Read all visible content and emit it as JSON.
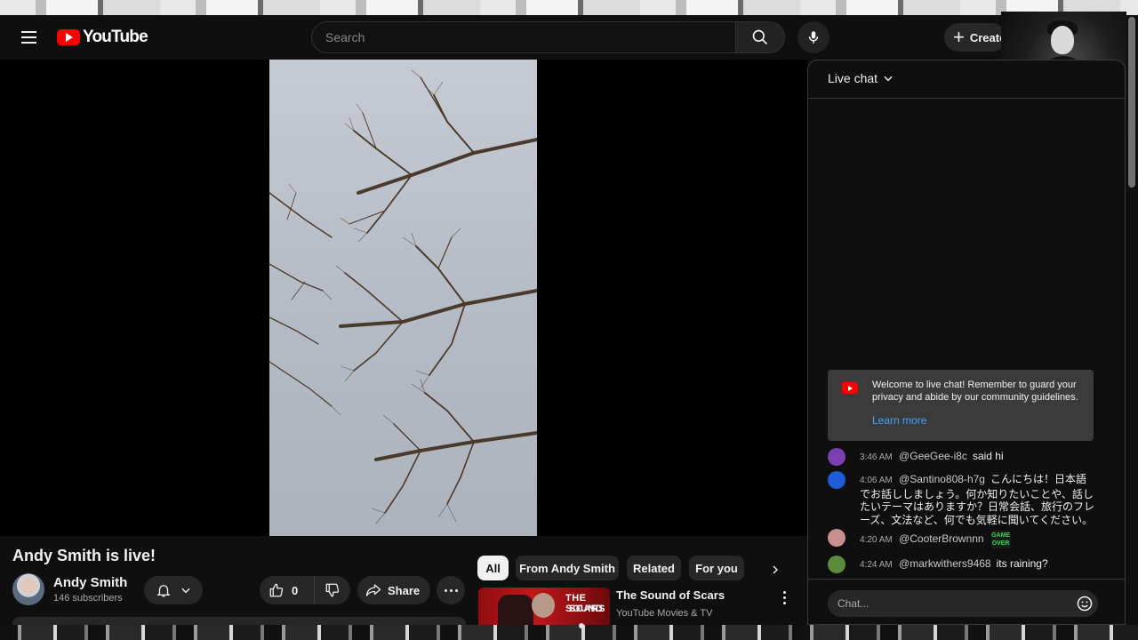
{
  "masthead": {
    "logo_text": "YouTube",
    "search_placeholder": "Search",
    "create_label": "Create"
  },
  "video": {
    "title": "Andy Smith is live!",
    "channel_name": "Andy Smith",
    "subscribers": "146 subscribers",
    "like_count": "0",
    "share_label": "Share"
  },
  "chips": [
    {
      "label": "All",
      "active": true
    },
    {
      "label": "From Andy Smith",
      "active": false
    },
    {
      "label": "Related",
      "active": false
    },
    {
      "label": "For you",
      "active": false
    }
  ],
  "recommended": {
    "title": "The Sound of Scars",
    "channel": "YouTube Movies & TV",
    "thumb_line1": "THE SOUND",
    "thumb_line2": "SCARS"
  },
  "chat": {
    "header_label": "Live chat",
    "welcome_text": "Welcome to live chat! Remember to guard your privacy and abide by our community guidelines.",
    "welcome_link": "Learn more",
    "input_placeholder": "Chat...",
    "messages": [
      {
        "time": "3:46 AM",
        "author": "@GeeGee-i8c",
        "text": "said hi",
        "avatar_color": "#7b3fb0"
      },
      {
        "time": "4:06 AM",
        "author": "@Santino808-h7g",
        "text": "こんにちは！日本語でお話ししましょう。何か知りたいことや、話したいテーマはありますか？日常会話、旅行のフレーズ、文法など、何でも気軽に聞いてください。",
        "avatar_color": "#1e5bd8"
      },
      {
        "time": "4:20 AM",
        "author": "@CooterBrownnn",
        "text": "",
        "emote": "GAME OVER",
        "avatar_color": "#c98f8f"
      },
      {
        "time": "4:24 AM",
        "author": "@markwithers9468",
        "text": "its raining?",
        "avatar_color": "#5a8a3a"
      }
    ]
  },
  "colors": {
    "background": "#0f0f0f",
    "surface": "#272727",
    "brand_red": "#ff0000",
    "link_blue": "#3ea6ff"
  }
}
